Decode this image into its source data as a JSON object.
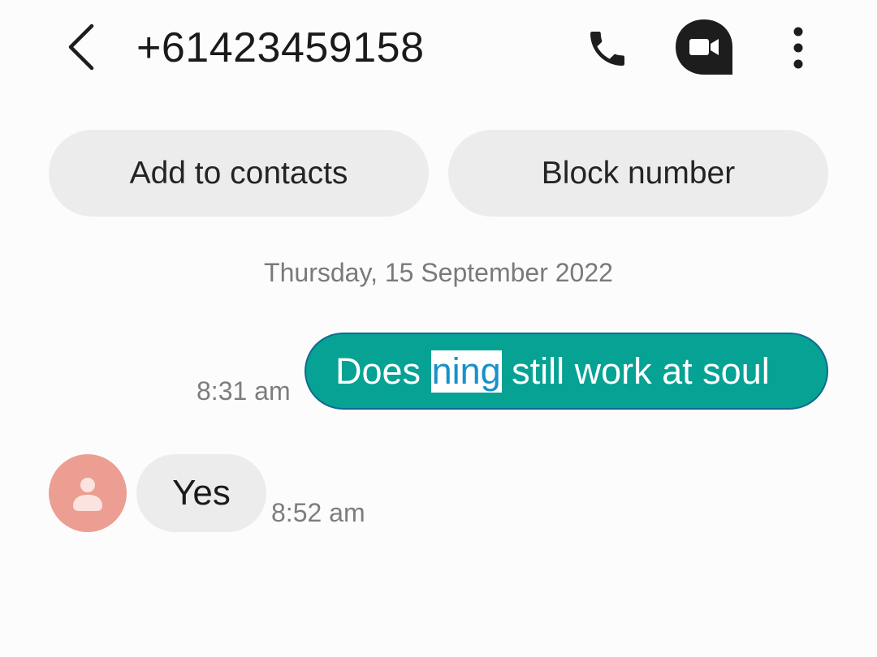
{
  "header": {
    "phone_number": "+61423459158",
    "back_icon": "chevron-left-icon",
    "call_icon": "phone-icon",
    "video_icon": "video-camera-icon",
    "more_icon": "more-vertical-icon"
  },
  "actions": {
    "add_to_contacts": "Add to contacts",
    "block_number": "Block number"
  },
  "conversation": {
    "date_separator": "Thursday, 15 September 2022",
    "messages": [
      {
        "direction": "outgoing",
        "text_before": "Does ",
        "selected_text": "ning",
        "text_after": " still work at soul",
        "time": "8:31 am"
      },
      {
        "direction": "incoming",
        "text": "Yes",
        "time": "8:52 am",
        "avatar_icon": "person-icon"
      }
    ]
  },
  "colors": {
    "outgoing_bubble": "#06a294",
    "incoming_bubble": "#ececec",
    "avatar": "#ec9e92",
    "selection_text": "#1791c9"
  }
}
